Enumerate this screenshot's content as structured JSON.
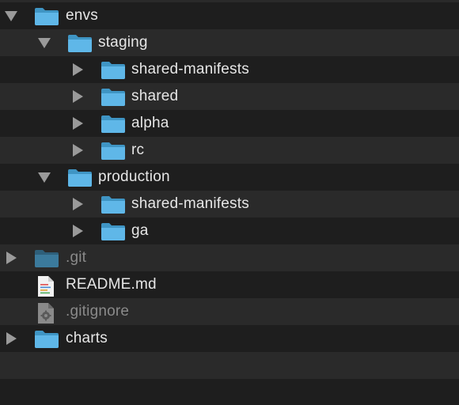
{
  "tree": {
    "items": [
      {
        "label": "envs",
        "icon": "folder-icon",
        "expanded": true
      },
      {
        "label": "staging",
        "icon": "folder-icon",
        "expanded": true
      },
      {
        "label": "shared-manifests",
        "icon": "folder-icon",
        "expanded": false
      },
      {
        "label": "shared",
        "icon": "folder-icon",
        "expanded": false
      },
      {
        "label": "alpha",
        "icon": "folder-icon",
        "expanded": false
      },
      {
        "label": "rc",
        "icon": "folder-icon",
        "expanded": false
      },
      {
        "label": "production",
        "icon": "folder-icon",
        "expanded": true
      },
      {
        "label": "shared-manifests",
        "icon": "folder-icon",
        "expanded": false
      },
      {
        "label": "ga",
        "icon": "folder-icon",
        "expanded": false
      },
      {
        "label": ".git",
        "icon": "folder-icon",
        "expanded": false,
        "dimmed": true
      },
      {
        "label": "README.md",
        "icon": "markdown-file-icon"
      },
      {
        "label": ".gitignore",
        "icon": "settings-file-icon",
        "dimmed": true
      },
      {
        "label": "charts",
        "icon": "folder-icon",
        "expanded": false
      }
    ]
  },
  "colors": {
    "background": "#1e1e1e",
    "alternate_row": "#2a2a2a",
    "folder": "#5fb7e8",
    "text": "#e6e6e6",
    "dimmed_text": "#8a8a8a"
  }
}
